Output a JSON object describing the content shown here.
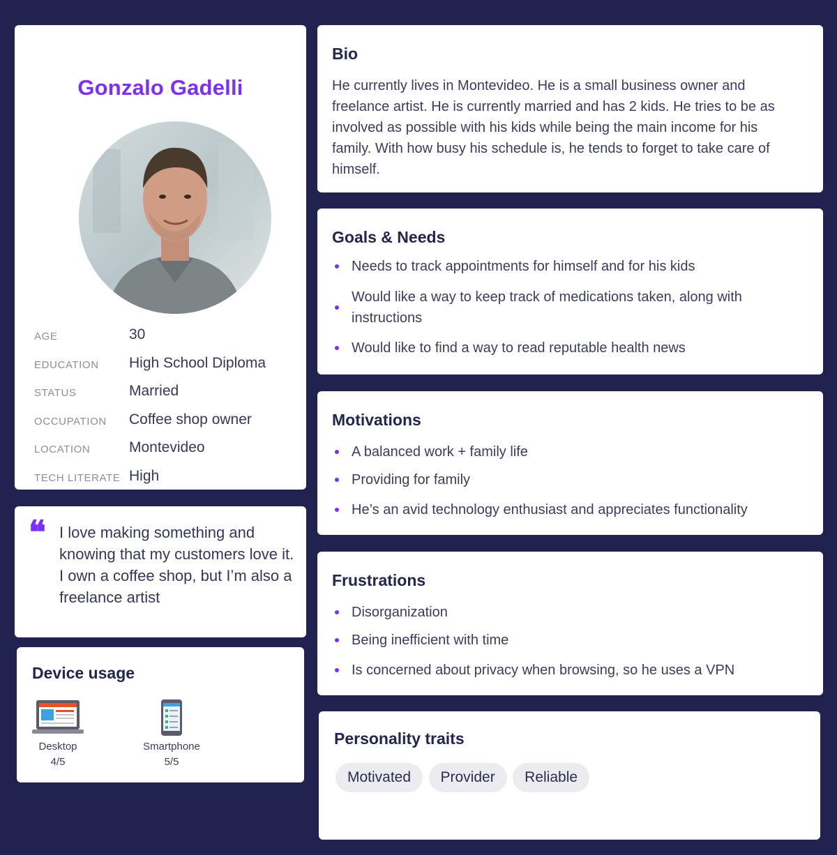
{
  "profile": {
    "name": "Gonzalo Gadelli",
    "fields": [
      {
        "label": "AGE",
        "value": "30"
      },
      {
        "label": "EDUCATION",
        "value": "High School Diploma"
      },
      {
        "label": "STATUS",
        "value": "Married"
      },
      {
        "label": "OCCUPATION",
        "value": "Coffee shop owner"
      },
      {
        "label": "LOCATION",
        "value": "Montevideo"
      },
      {
        "label": "TECH LITERATE",
        "value": "High"
      }
    ]
  },
  "quote": {
    "mark": "❝",
    "text": "I love making something and knowing that my customers love it. I own a coffee shop, but I’m also a freelance artist"
  },
  "device_usage": {
    "title": "Device usage",
    "devices": [
      {
        "name": "Desktop",
        "rating": "4/5",
        "icon": "laptop-icon"
      },
      {
        "name": "Smartphone",
        "rating": "5/5",
        "icon": "smartphone-icon"
      }
    ]
  },
  "bio": {
    "title": "Bio",
    "text": "He currently lives in Montevideo. He is a small business owner and freelance artist. He is currently married and has 2 kids. He tries to  be as involved as possible with his kids while being the main income for his family. With how busy his schedule is, he tends to forget to take care of himself."
  },
  "goals": {
    "title": "Goals & Needs",
    "items": [
      "Needs to track appointments for himself and for his kids",
      "Would like a way to keep track of medications taken, along with instructions",
      "Would like to find a way to read reputable health news"
    ]
  },
  "motivations": {
    "title": "Motivations",
    "items": [
      "A balanced work + family life",
      "Providing for family",
      "He’s an avid technology enthusiast and appreciates functionality"
    ]
  },
  "frustrations": {
    "title": "Frustrations",
    "items": [
      "Disorganization",
      "Being inefficient with time",
      "Is concerned about privacy when browsing, so he uses a VPN"
    ]
  },
  "personality": {
    "title": "Personality traits",
    "traits": [
      "Motivated",
      "Provider",
      "Reliable"
    ]
  },
  "colors": {
    "background": "#21224f",
    "accent": "#7b2ff7",
    "card": "#ffffff",
    "chip": "#ececf0"
  }
}
